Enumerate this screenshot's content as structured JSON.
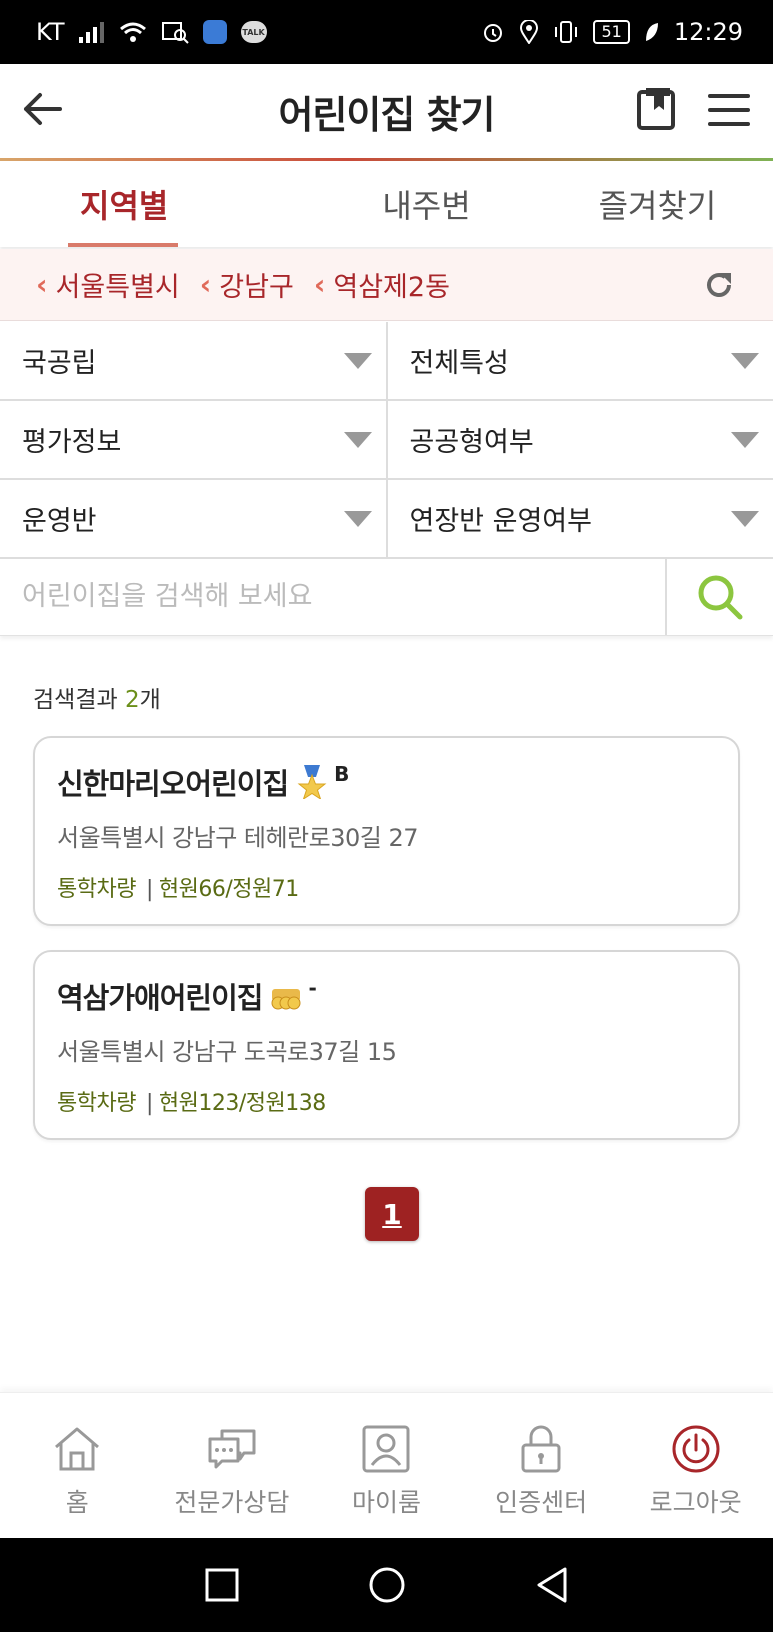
{
  "status_bar": {
    "carrier": "KT",
    "battery": "51",
    "time": "12:29",
    "talk_label": "TALK"
  },
  "header": {
    "title": "어린이집 찾기"
  },
  "tabs": [
    {
      "label": "지역별",
      "active": true
    },
    {
      "label": "내주변",
      "active": false
    },
    {
      "label": "즐겨찾기",
      "active": false
    }
  ],
  "breadcrumb": {
    "items": [
      "서울특별시",
      "강남구",
      "역삼제2동"
    ]
  },
  "filters": {
    "rows": [
      [
        "국공립",
        "전체특성"
      ],
      [
        "평가정보",
        "공공형여부"
      ],
      [
        "운영반",
        "연장반 운영여부"
      ]
    ]
  },
  "search": {
    "placeholder": "어린이집을 검색해 보세요",
    "value": ""
  },
  "results": {
    "label": "검색결과 ",
    "count": "2",
    "unit": "개",
    "items": [
      {
        "name": "신한마리오어린이집",
        "grade": "B",
        "badge": "medal-icon",
        "address": "서울특별시 강남구 테헤란로30길 27",
        "bus": "통학차량",
        "capacity": "현원66/정원71"
      },
      {
        "name": "역삼가애어린이집",
        "grade": "-",
        "badge": "coins-icon",
        "address": "서울특별시 강남구 도곡로37길 15",
        "bus": "통학차량",
        "capacity": "현원123/정원138"
      }
    ]
  },
  "pagination": {
    "current": "1"
  },
  "bottom_nav": [
    {
      "label": "홈",
      "icon": "home-icon"
    },
    {
      "label": "전문가상담",
      "icon": "chat-icon"
    },
    {
      "label": "마이룸",
      "icon": "user-icon"
    },
    {
      "label": "인증센터",
      "icon": "lock-icon"
    },
    {
      "label": "로그아웃",
      "icon": "power-icon"
    }
  ],
  "colors": {
    "accent": "#a8262a",
    "search_icon": "#8cc63f",
    "meta_text": "#5a6b14"
  }
}
